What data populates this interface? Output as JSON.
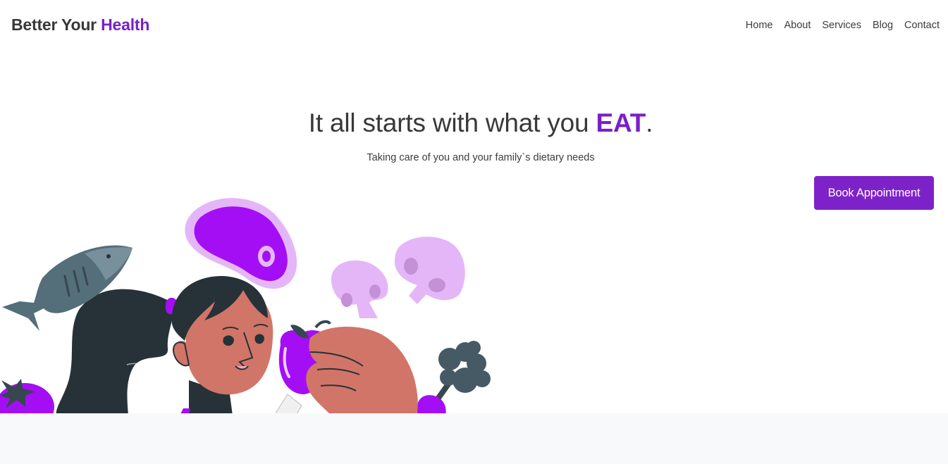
{
  "brand": {
    "prefix": "Better Your",
    "accent": "Health"
  },
  "nav": {
    "items": [
      "Home",
      "About",
      "Services",
      "Blog",
      "Contact"
    ]
  },
  "hero": {
    "title_prefix": "It all starts with what you",
    "title_accent": "EAT",
    "title_suffix": ".",
    "subtitle": "Taking care of you and your family`s dietary needs",
    "cta_label": "Book Appointment"
  },
  "colors": {
    "accent": "#7a1fc8",
    "button": "#7d22c9",
    "text": "#383838",
    "footer_band": "#f8f9fa"
  },
  "illustration": {
    "subject": "girl-eating-healthy-food",
    "icons": [
      "fish-icon",
      "steak-icon",
      "mushroom-icon",
      "apple-icon",
      "broccoli-icon",
      "tomato-icon"
    ]
  }
}
